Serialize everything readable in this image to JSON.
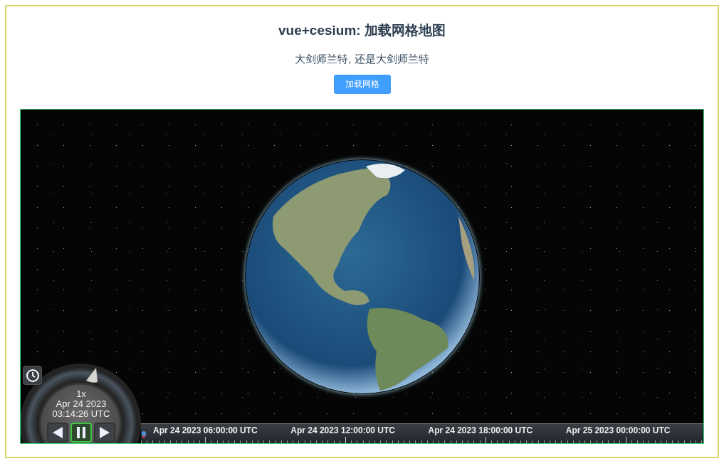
{
  "title": "vue+cesium: 加载网格地图",
  "subtitle": "大剑师兰特, 还是大剑师兰特",
  "load_button": "加载网格",
  "animation": {
    "speed": "1x",
    "date": "Apr 24 2023",
    "time": "03:14:26 UTC",
    "controls": [
      {
        "kind": "reverse",
        "selected": false
      },
      {
        "kind": "pause",
        "selected": true
      },
      {
        "kind": "play",
        "selected": false
      }
    ]
  },
  "timeline": {
    "labels": [
      "Apr 24 2023 06:00:00 UTC",
      "Apr 24 2023 12:00:00 UTC",
      "Apr 24 2023 18:00:00 UTC",
      "Apr 25 2023 00:00:00 UTC"
    ]
  }
}
